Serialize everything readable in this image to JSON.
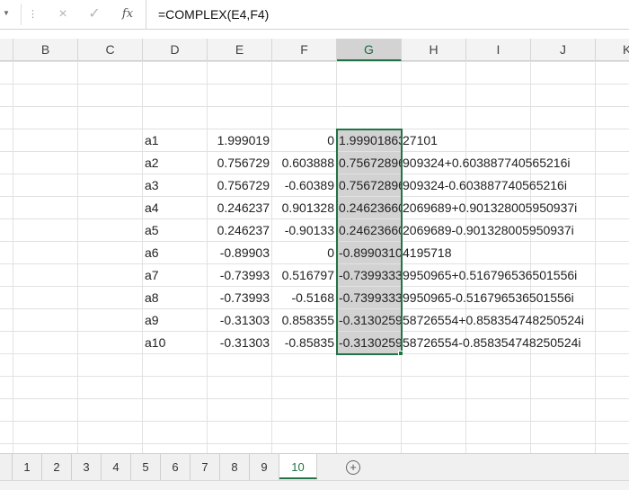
{
  "formula_bar": {
    "content": "=COMPLEX(E4,F4)",
    "cancel_icon": "×",
    "enter_icon": "✓",
    "fx_label": "fx"
  },
  "columns": [
    "B",
    "C",
    "D",
    "E",
    "F",
    "G",
    "H",
    "I",
    "J",
    "K"
  ],
  "selected_column": "G",
  "rows": [
    {
      "d": "a1",
      "e": "1.999019",
      "f": "0",
      "g": "1.99901863",
      "tail": "27101"
    },
    {
      "d": "a2",
      "e": "0.756729",
      "f": "0.603888",
      "g": "0.75672896",
      "tail": "909324+0.603887740565216i"
    },
    {
      "d": "a3",
      "e": "0.756729",
      "f": "-0.60389",
      "g": "0.75672896",
      "tail": "909324-0.603887740565216i"
    },
    {
      "d": "a4",
      "e": "0.246237",
      "f": "0.901328",
      "g": "0.24623660",
      "tail": "2069689+0.901328005950937i"
    },
    {
      "d": "a5",
      "e": "0.246237",
      "f": "-0.90133",
      "g": "0.24623660",
      "tail": "2069689-0.901328005950937i"
    },
    {
      "d": "a6",
      "e": "-0.89903",
      "f": "0",
      "g": "-0.89903109",
      "tail": "4195718"
    },
    {
      "d": "a7",
      "e": "-0.73993",
      "f": "0.516797",
      "g": "-0.7399333",
      "tail": "9950965+0.516796536501556i"
    },
    {
      "d": "a8",
      "e": "-0.73993",
      "f": "-0.5168",
      "g": "-0.7399333",
      "tail": "9950965-0.516796536501556i"
    },
    {
      "d": "a9",
      "e": "-0.31303",
      "f": "0.858355",
      "g": "-0.3130259",
      "tail": "58726554+0.858354748250524i"
    },
    {
      "d": "a10",
      "e": "-0.31303",
      "f": "-0.85835",
      "g": "-0.3130259",
      "tail": "58726554-0.858354748250524i"
    }
  ],
  "sheet_tabs": [
    "1",
    "2",
    "3",
    "4",
    "5",
    "6",
    "7",
    "8",
    "9",
    "10"
  ],
  "active_tab": "10",
  "add_sheet_icon": "+",
  "colors": {
    "accent": "#217346",
    "selection": "#d2d2d2"
  }
}
